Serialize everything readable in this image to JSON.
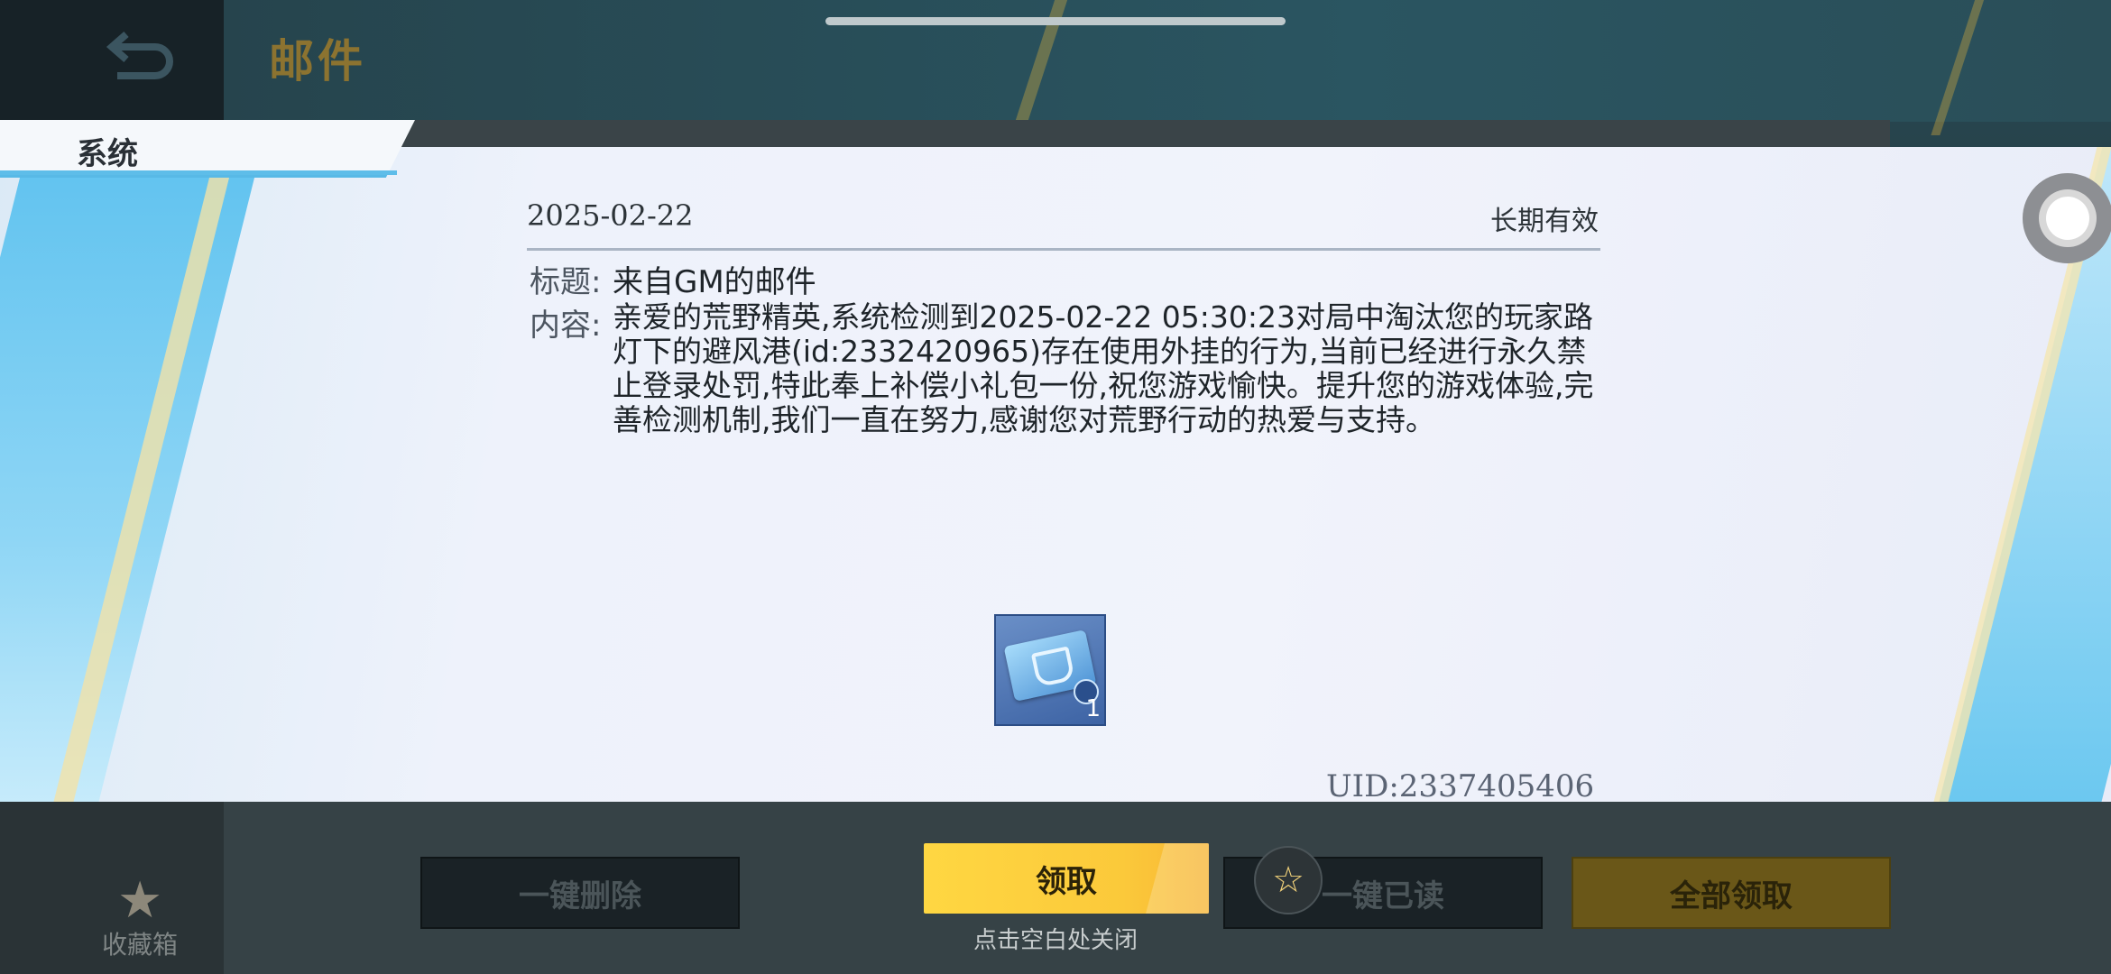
{
  "header": {
    "title": "邮件",
    "back_icon": "back-arrow-icon"
  },
  "tabs": [
    {
      "label": "系统",
      "active": true
    }
  ],
  "mail": {
    "date": "2025-02-22",
    "validity": "长期有效",
    "title_label": "标题:",
    "title": "来自GM的邮件",
    "content_label": "内容:",
    "content": "亲爱的荒野精英,系统检测到2025-02-22 05:30:23对局中淘汰您的玩家路灯下的避风港(id:2332420965)存在使用外挂的行为,当前已经进行永久禁止登录处罚,特此奉上补偿小礼包一份,祝您游戏愉快。提升您的游戏体验,完善检测机制,我们一直在努力,感谢您对荒野行动的热爱与支持。",
    "attachment": {
      "icon": "gift-ticket-icon",
      "quantity": "1"
    },
    "uid": "UID:2337405406"
  },
  "sidebar": {
    "favorites_label": "收藏箱",
    "favorites_icon": "star-icon"
  },
  "actions": {
    "delete_all": "一键删除",
    "claim": "领取",
    "close_hint": "点击空白处关闭",
    "read_all": "一键已读",
    "claim_all": "全部领取"
  },
  "colors": {
    "claim_button": "#fbc93a",
    "tab_accent": "#5ebde9",
    "title_gold": "#8c7330"
  }
}
